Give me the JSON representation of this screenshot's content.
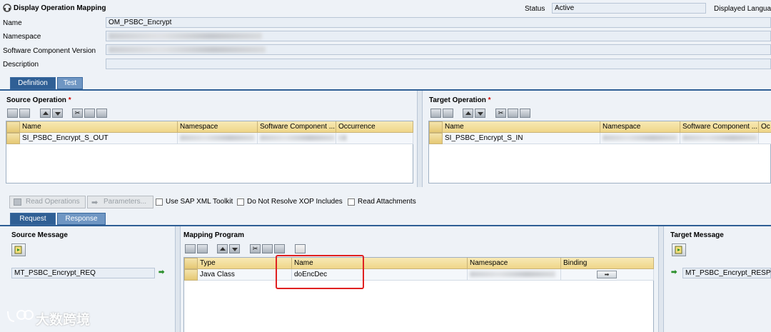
{
  "header": {
    "title": "Display Operation Mapping",
    "status_label": "Status",
    "status_value": "Active",
    "displayed_lang_label": "Displayed Langua"
  },
  "form": {
    "name_label": "Name",
    "name_value": "OM_PSBC_Encrypt",
    "namespace_label": "Namespace",
    "swcv_label": "Software Component Version",
    "description_label": "Description"
  },
  "tabs": {
    "definition": "Definition",
    "test": "Test",
    "request": "Request",
    "response": "Response"
  },
  "source_operation": {
    "title": "Source Operation",
    "required": "*",
    "columns": [
      "Name",
      "Namespace",
      "Software Component ...",
      "Occurrence"
    ],
    "row_name": "SI_PSBC_Encrypt_S_OUT"
  },
  "target_operation": {
    "title": "Target Operation",
    "required": "*",
    "columns": [
      "Name",
      "Namespace",
      "Software Component ...",
      "Oc"
    ],
    "row_name": "SI_PSBC_Encrypt_S_IN"
  },
  "actions": {
    "read_operations": "Read Operations",
    "parameters": "Parameters...",
    "use_sap_xml_toolkit": "Use SAP XML Toolkit",
    "do_not_resolve_xop": "Do Not Resolve XOP Includes",
    "read_attachments": "Read Attachments"
  },
  "source_message": {
    "title": "Source Message",
    "value": "MT_PSBC_Encrypt_REQ"
  },
  "mapping_program": {
    "title": "Mapping Program",
    "columns": [
      "Type",
      "Name",
      "Namespace",
      "Binding"
    ],
    "row": {
      "type": "Java Class",
      "name": "doEncDec"
    }
  },
  "target_message": {
    "title": "Target Message",
    "value": "MT_PSBC_Encrypt_RESP"
  },
  "watermark": "大数跨境",
  "colors": {
    "tab_active": "#2f5f95",
    "tab_inactive": "#6f96c3",
    "table_header": "#efd689",
    "highlight": "#e02020",
    "required": "#d00000"
  }
}
